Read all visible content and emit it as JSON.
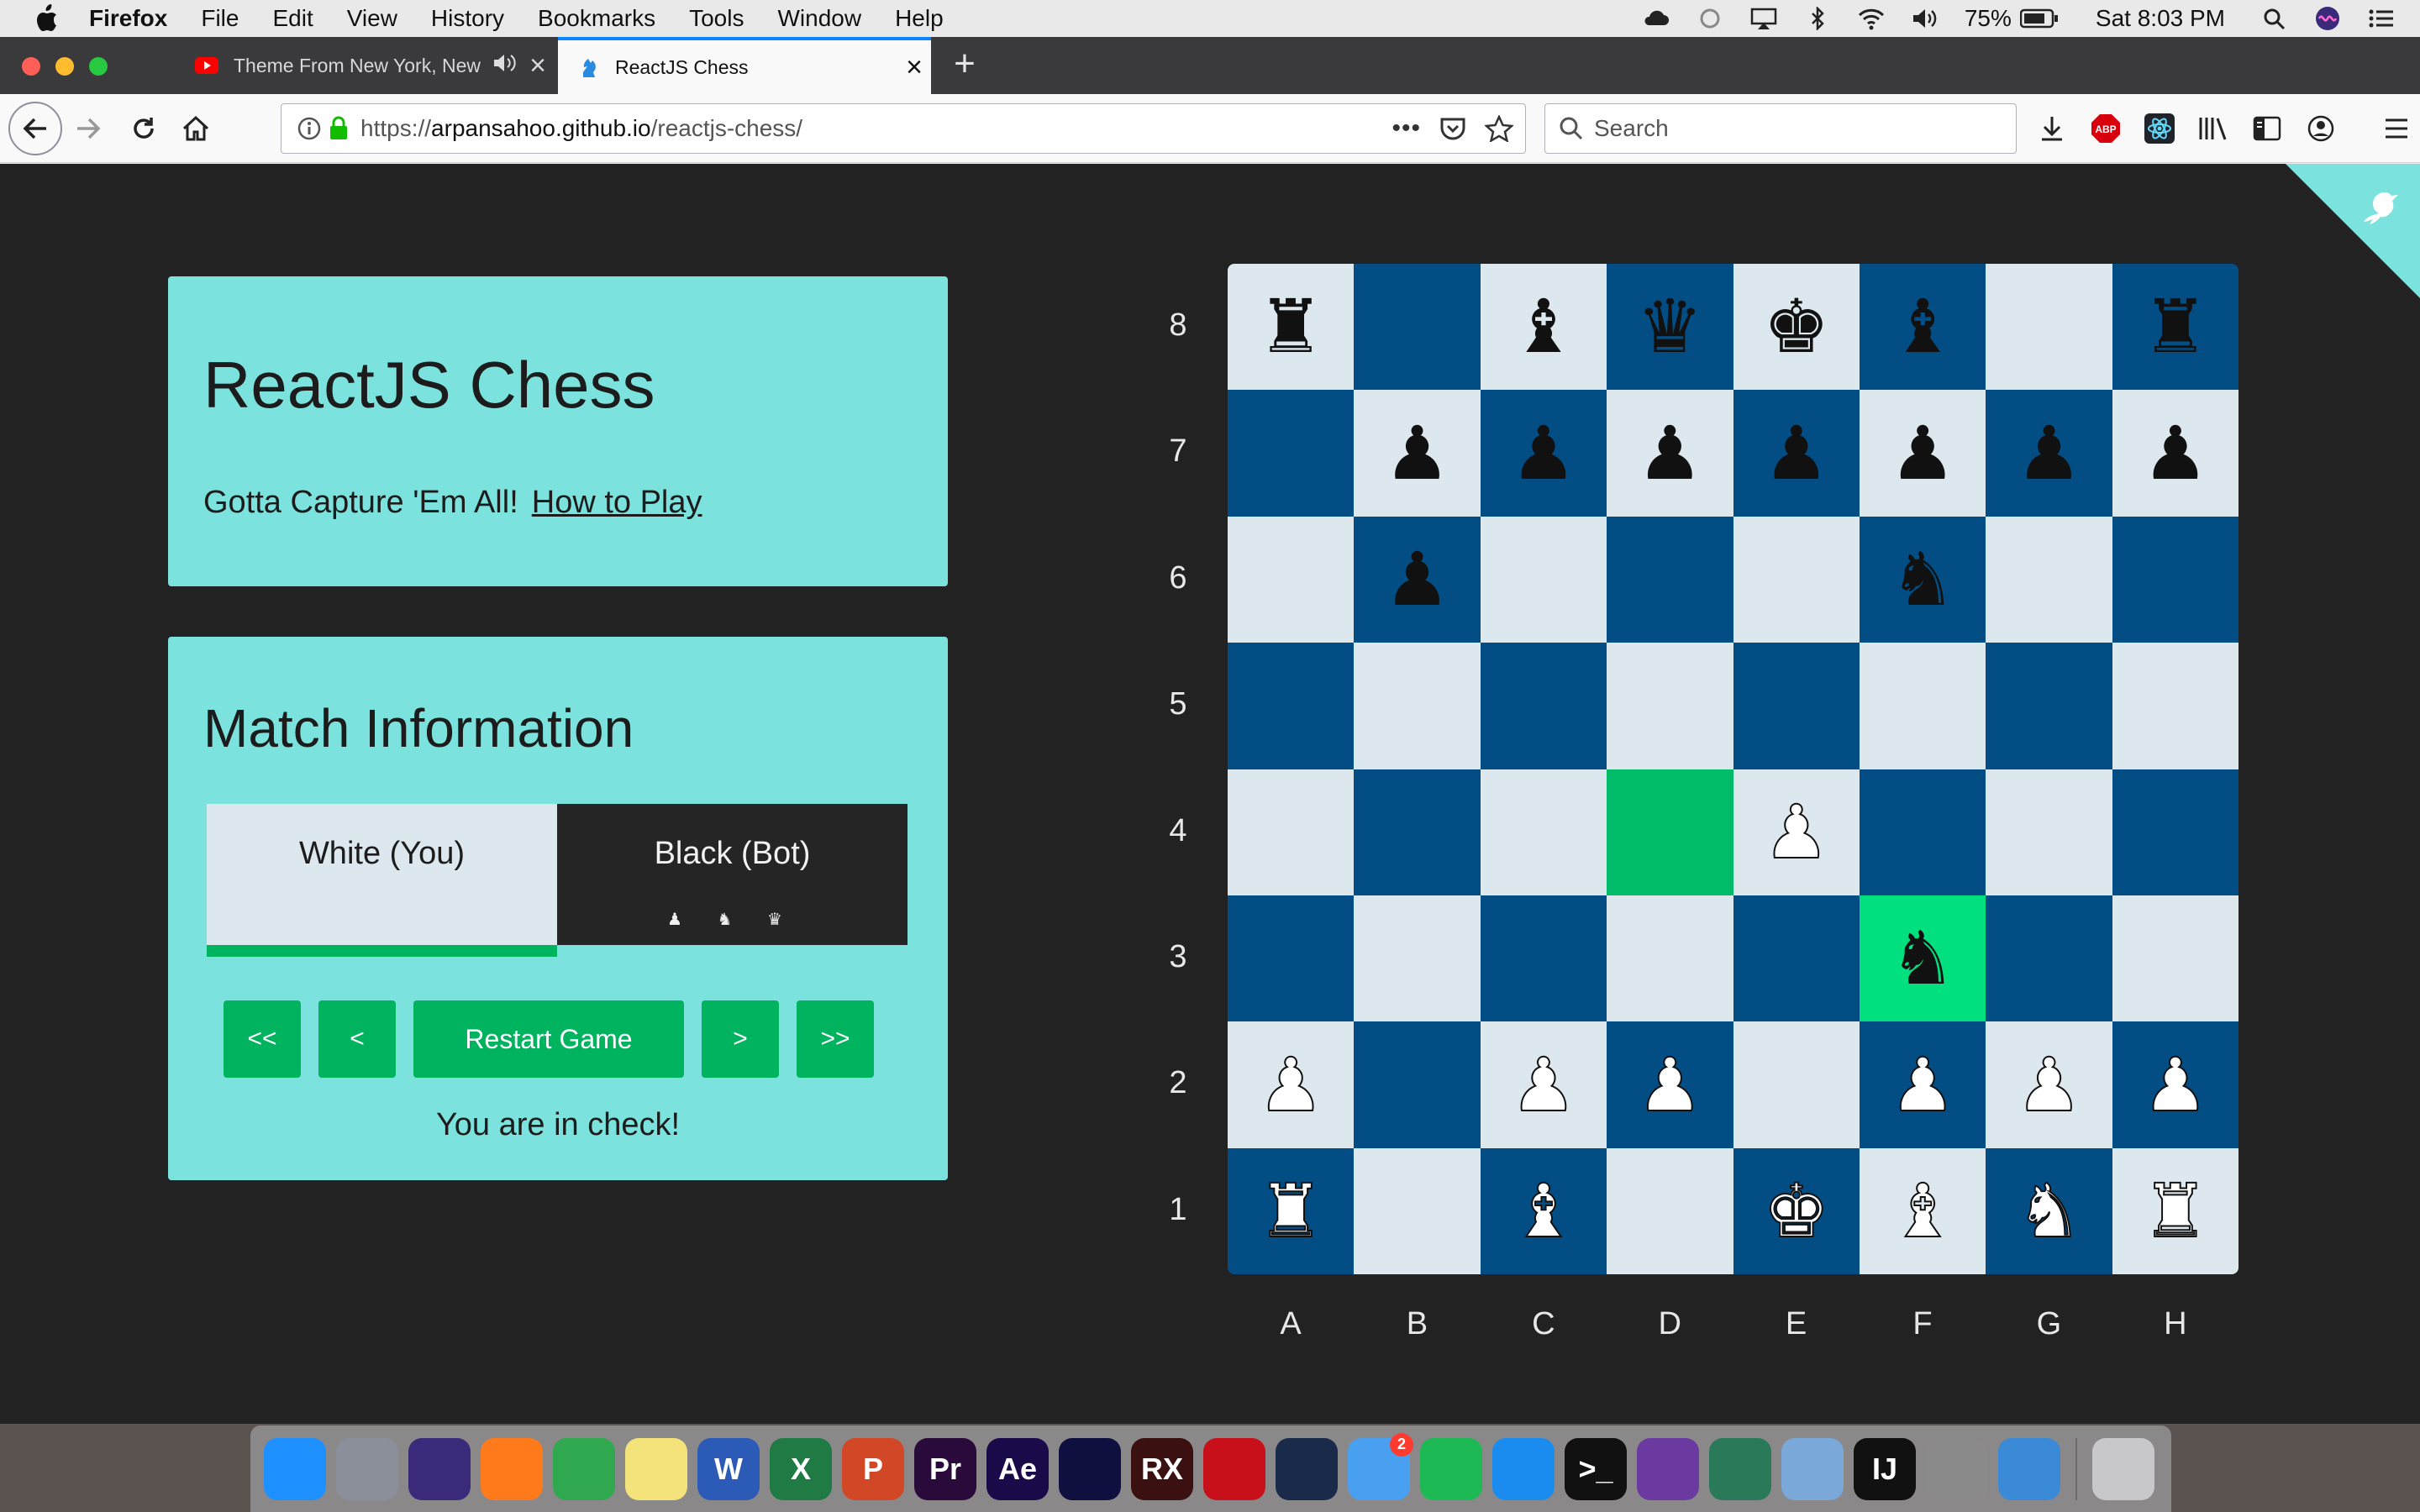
{
  "menubar": {
    "app": "Firefox",
    "items": [
      "File",
      "Edit",
      "View",
      "History",
      "Bookmarks",
      "Tools",
      "Window",
      "Help"
    ],
    "battery": "75%",
    "clock": "Sat 8:03 PM"
  },
  "tabs": {
    "inactive_title": "Theme From New York, New",
    "active_title": "ReactJS Chess"
  },
  "navbar": {
    "url_scheme": "https://",
    "url_domain": "arpansahoo.github.io",
    "url_path": "/reactjs-chess/",
    "search_placeholder": "Search"
  },
  "app": {
    "title": "ReactJS Chess",
    "tagline": "Gotta Capture 'Em All!",
    "how_to_play": "How to Play",
    "match_heading": "Match Information",
    "white_player": "White (You)",
    "black_player": "Black (Bot)",
    "black_captured": "♟ ♞ ♛",
    "buttons": {
      "first": "<<",
      "prev": "<",
      "restart": "Restart Game",
      "next": ">",
      "last": ">>"
    },
    "status": "You are in check!"
  },
  "board": {
    "ranks": [
      "8",
      "7",
      "6",
      "5",
      "4",
      "3",
      "2",
      "1"
    ],
    "files": [
      "A",
      "B",
      "C",
      "D",
      "E",
      "F",
      "G",
      "H"
    ],
    "squares": [
      [
        "br",
        "",
        "bb",
        "bq",
        "bk",
        "bb",
        "",
        "br"
      ],
      [
        "",
        "bp",
        "bp",
        "bp",
        "bp",
        "bp",
        "bp",
        "bp"
      ],
      [
        "",
        "bp",
        "",
        "",
        "",
        "bn",
        "",
        ""
      ],
      [
        "",
        "",
        "",
        "",
        "",
        "",
        "",
        ""
      ],
      [
        "",
        "",
        "",
        "",
        "wp",
        "",
        "",
        ""
      ],
      [
        "",
        "",
        "",
        "",
        "",
        "bn",
        "",
        ""
      ],
      [
        "wp",
        "",
        "wp",
        "wp",
        "",
        "wp",
        "wp",
        "wp"
      ],
      [
        "wr",
        "",
        "wb",
        "",
        "wk",
        "wb",
        "wn",
        "wr"
      ]
    ],
    "highlight_move": "D4",
    "highlight_selected": "F3",
    "colors": {
      "light": "#dde8ee",
      "dark": "#024e84",
      "move": "#00bb6a",
      "selected": "#00e07e"
    }
  },
  "dock": {
    "apps": [
      {
        "name": "finder",
        "label": "",
        "color": "#1e90ff"
      },
      {
        "name": "launchpad",
        "label": "",
        "color": "#8a8f99"
      },
      {
        "name": "siri",
        "label": "",
        "color": "#3b2a7a"
      },
      {
        "name": "firefox",
        "label": "",
        "color": "#ff7a1a"
      },
      {
        "name": "chrome",
        "label": "",
        "color": "#2fa84f"
      },
      {
        "name": "notes",
        "label": "",
        "color": "#f4e27a"
      },
      {
        "name": "word",
        "label": "W",
        "color": "#2b5bb7"
      },
      {
        "name": "excel",
        "label": "X",
        "color": "#1f7a43"
      },
      {
        "name": "powerpoint",
        "label": "P",
        "color": "#d24726"
      },
      {
        "name": "premiere",
        "label": "Pr",
        "color": "#2a0a3a"
      },
      {
        "name": "after-effects",
        "label": "Ae",
        "color": "#1a0a4a"
      },
      {
        "name": "media-encoder",
        "label": "",
        "color": "#101040"
      },
      {
        "name": "rx",
        "label": "RX",
        "color": "#3a1010"
      },
      {
        "name": "acrobat",
        "label": "",
        "color": "#c8101a"
      },
      {
        "name": "quicktime",
        "label": "",
        "color": "#1a2a4a"
      },
      {
        "name": "messages",
        "label": "",
        "color": "#4aa0f0",
        "badge": "2"
      },
      {
        "name": "spotify",
        "label": "",
        "color": "#1db954"
      },
      {
        "name": "app-store",
        "label": "",
        "color": "#1a8cf0"
      },
      {
        "name": "terminal",
        "label": ">_",
        "color": "#111111"
      },
      {
        "name": "github-desktop",
        "label": "",
        "color": "#6a3aa0"
      },
      {
        "name": "atom",
        "label": "",
        "color": "#2a7a5a"
      },
      {
        "name": "preview",
        "label": "",
        "color": "#7aa8d8"
      },
      {
        "name": "intellij",
        "label": "IJ",
        "color": "#111111"
      },
      {
        "name": "system-preferences",
        "label": "",
        "color": "#8a8a8a"
      },
      {
        "name": "xcode",
        "label": "",
        "color": "#3a8ad8"
      },
      {
        "name": "trash",
        "label": "",
        "color": "#c8c8cc"
      }
    ]
  }
}
